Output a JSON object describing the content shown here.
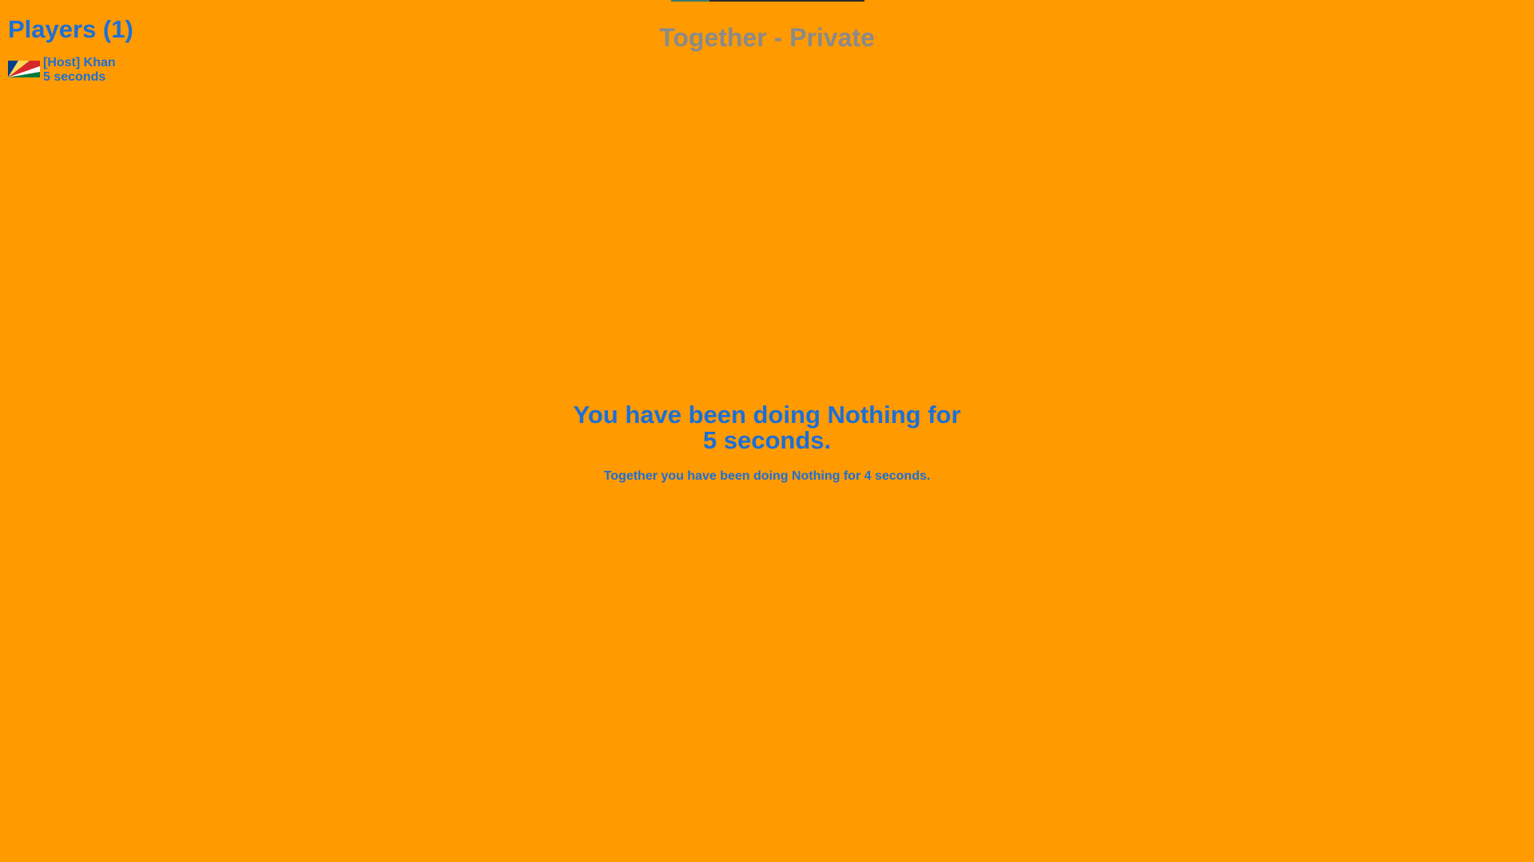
{
  "room": {
    "title": "Together - Private"
  },
  "players": {
    "heading": "Players (1)",
    "list": [
      {
        "name": "[Host] Khan",
        "time": "5 seconds",
        "flag_icon": "seychelles-flag-icon"
      }
    ]
  },
  "status": {
    "line1": "You have been doing Nothing for",
    "line2": "5 seconds.",
    "together": "Together you have been doing Nothing for 4 seconds."
  },
  "colors": {
    "background": "#ff9a00",
    "text_primary": "#1c6fd6",
    "text_muted": "#8a8a8a"
  }
}
